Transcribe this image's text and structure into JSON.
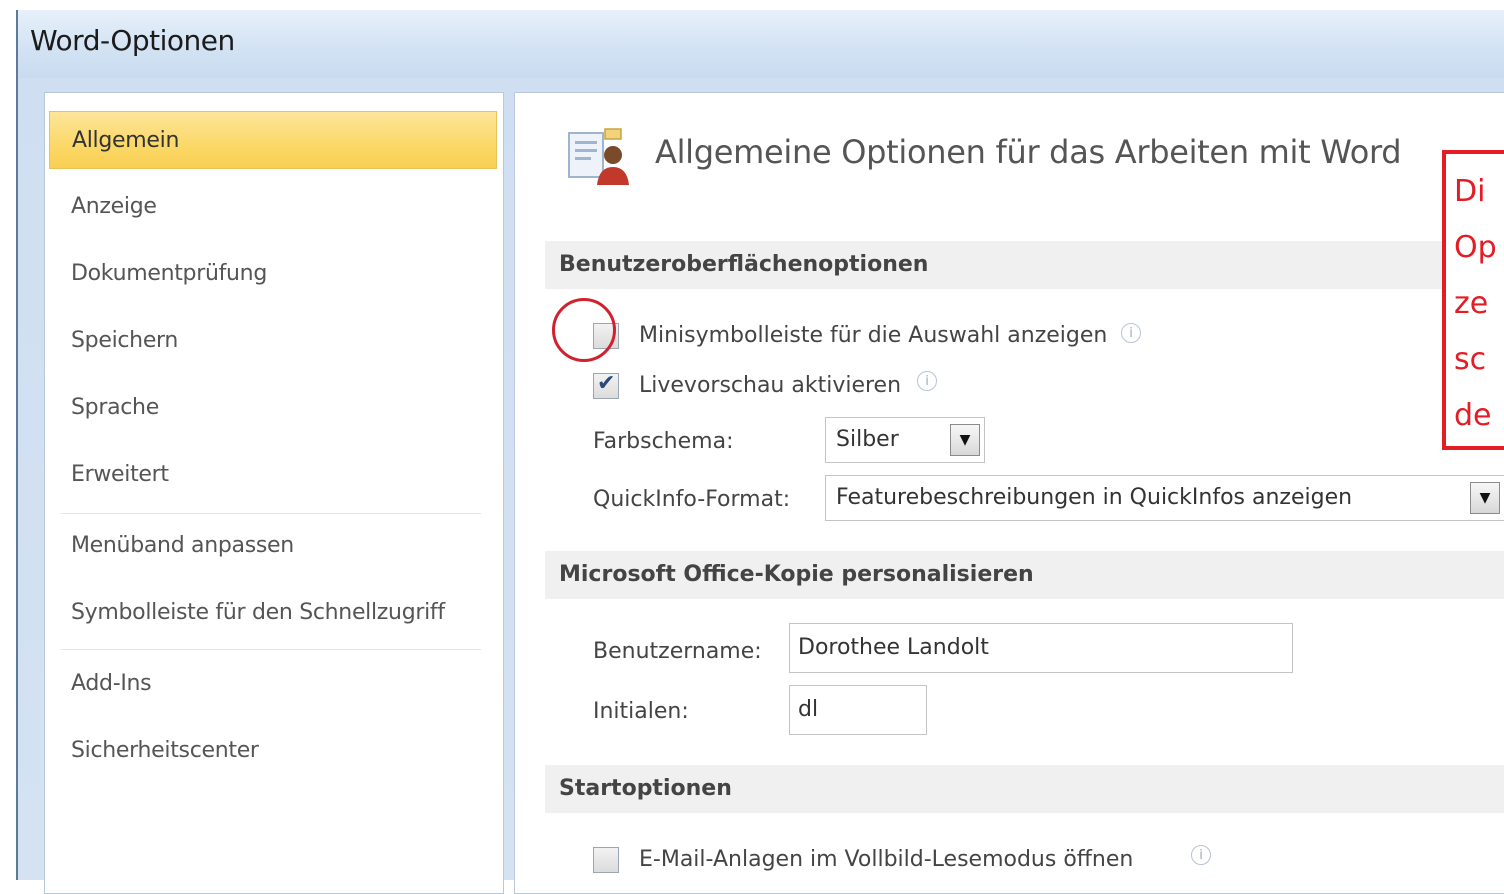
{
  "window": {
    "title": "Word-Optionen"
  },
  "sidebar": {
    "items": [
      {
        "label": "Allgemein",
        "active": true
      },
      {
        "label": "Anzeige"
      },
      {
        "label": "Dokumentprüfung"
      },
      {
        "label": "Speichern"
      },
      {
        "label": "Sprache"
      },
      {
        "label": "Erweitert"
      },
      {
        "label": "Menüband anpassen"
      },
      {
        "label": "Symbolleiste für den Schnellzugriff"
      },
      {
        "label": "Add-Ins"
      },
      {
        "label": "Sicherheitscenter"
      }
    ]
  },
  "main": {
    "header_title": "Allgemeine Optionen für das Arbeiten mit Word",
    "sections": {
      "ui": {
        "title": "Benutzeroberflächenoptionen",
        "minisymbol_label": "Minisymbolleiste für die Auswahl anzeigen",
        "minisymbol_checked": false,
        "livepreview_label": "Livevorschau aktivieren",
        "livepreview_checked": true,
        "colorscheme_label": "Farbschema:",
        "colorscheme_value": "Silber",
        "quickinfo_label": "QuickInfo-Format:",
        "quickinfo_value": "Featurebeschreibungen in QuickInfos anzeigen"
      },
      "personalize": {
        "title": "Microsoft Office-Kopie personalisieren",
        "username_label": "Benutzername:",
        "username_value": "Dorothee Landolt",
        "initials_label": "Initialen:",
        "initials_value": "dl"
      },
      "start": {
        "title": "Startoptionen",
        "email_label": "E-Mail-Anlagen im Vollbild-Lesemodus öffnen",
        "email_checked": false
      }
    }
  },
  "callout": {
    "lines": [
      "Di",
      "Op",
      "ze",
      "sc",
      "de"
    ]
  },
  "colors": {
    "active_nav": "#fbd867",
    "callout_red": "#e31c25",
    "highlight_circle": "#d0222e"
  }
}
